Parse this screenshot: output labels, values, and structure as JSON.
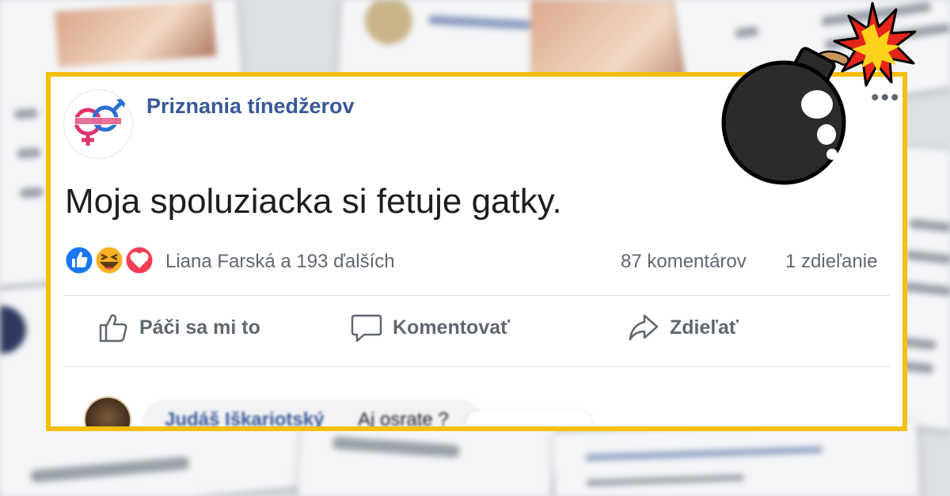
{
  "post": {
    "page_name": "Priznania tínedžerov",
    "text": "Moja spoluziacka si fetuje gatky.",
    "reaction_icons": [
      "like-icon",
      "haha-icon",
      "love-icon"
    ],
    "reaction_names": "Liana Farská a 193 ďalších",
    "comments_count": "87 komentárov",
    "shares_count": "1 zdieľanie"
  },
  "actions": {
    "like_label": "Páči sa mi to",
    "comment_label": "Komentovať",
    "share_label": "Zdieľať"
  },
  "comment": {
    "author": "Judáš Iškariotský",
    "text": "Aj osrate ?"
  },
  "colors": {
    "frame": "#f5bf0e",
    "link_blue": "#385898",
    "like_blue": "#1877f2",
    "love_red": "#f33e58",
    "haha_yellow": "#f7b125"
  }
}
